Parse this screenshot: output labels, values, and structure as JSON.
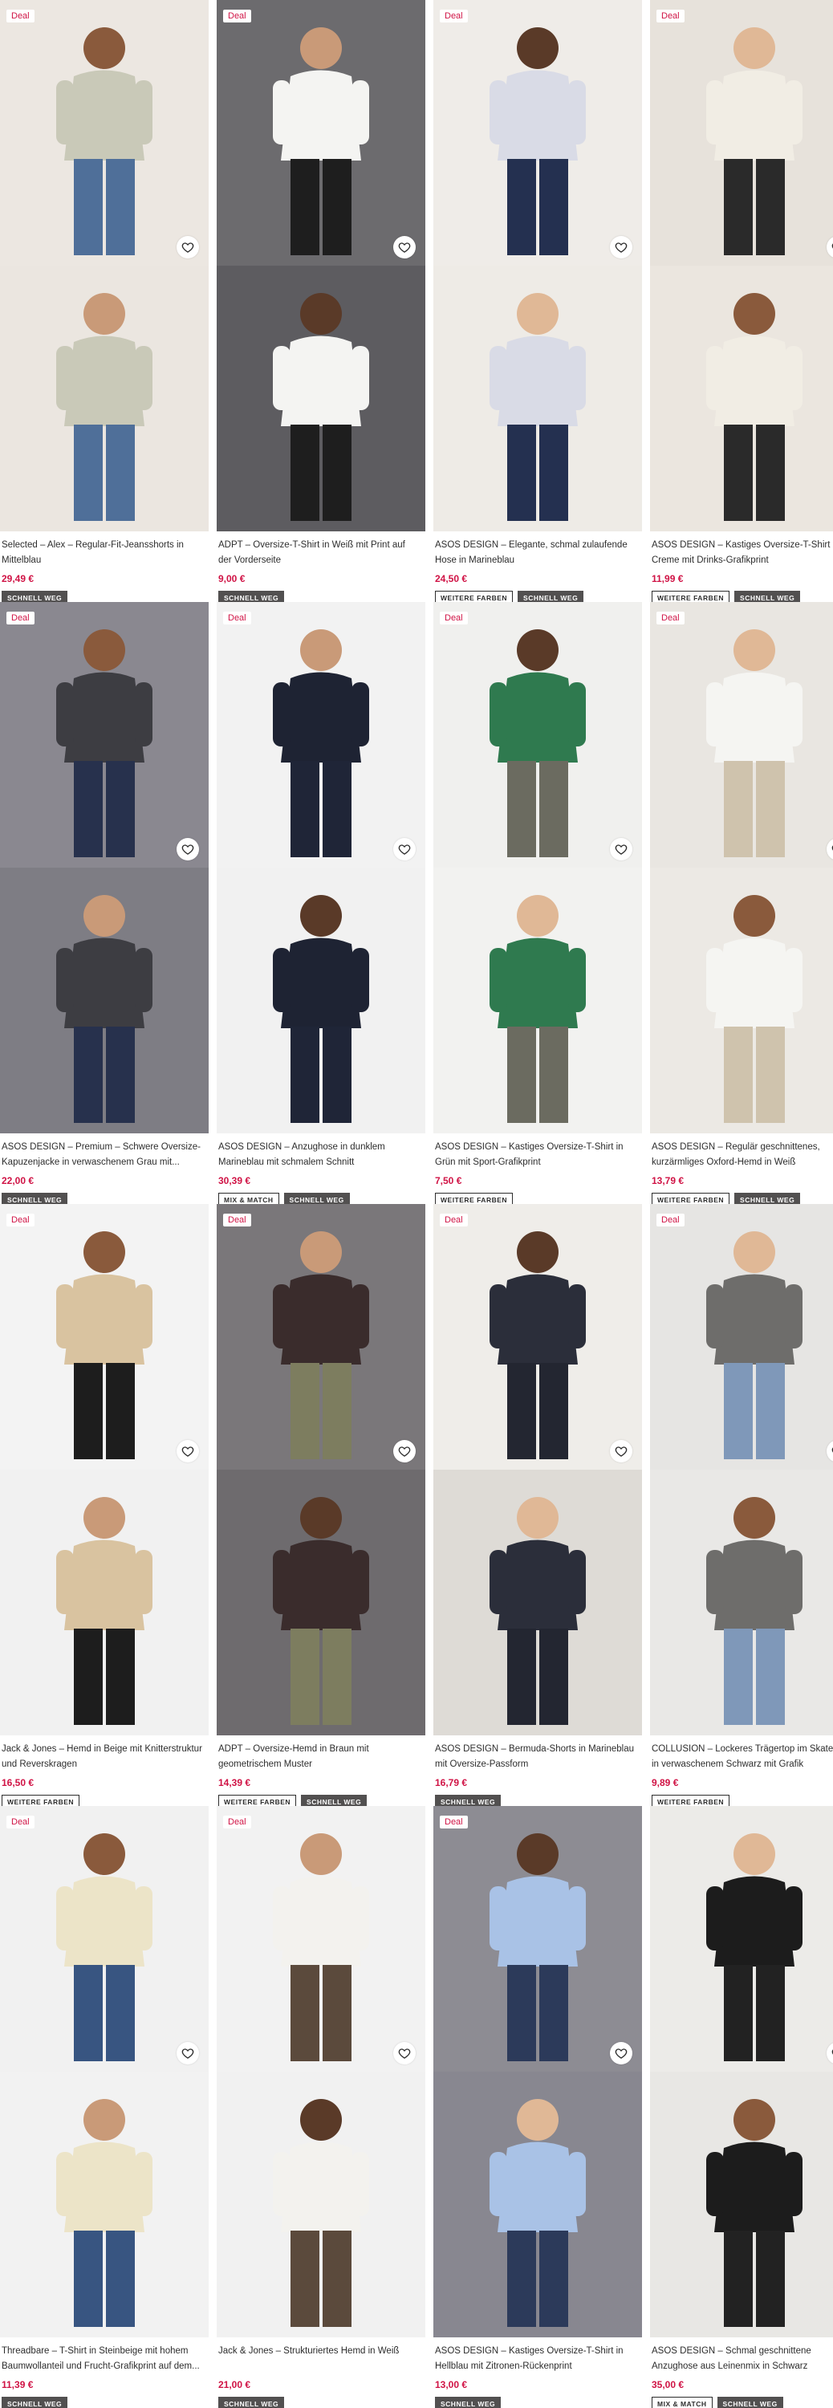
{
  "colors": {
    "price": "#d01345",
    "deal": "#d01345",
    "fast_badge_bg": "#525050"
  },
  "products": [
    {
      "title": "Selected – Alex – Regular-Fit-Jeansshorts in Mittelblau",
      "price": "29,49 €",
      "deal": "Deal",
      "badges": [
        "SCHNELL WEG"
      ],
      "bg1": "#ece7e1",
      "bg2": "#ebe6e0",
      "cloth1": "#c9c9b8",
      "cloth2": "#4f6f99"
    },
    {
      "title": "ADPT – Oversize-T-Shirt in Weiß mit Print auf der Vorderseite",
      "price": "9,00 €",
      "deal": "Deal",
      "badges": [
        "SCHNELL WEG"
      ],
      "bg1": "#6c6b6e",
      "bg2": "#5d5c60",
      "cloth1": "#f4f4f2",
      "cloth2": "#1e1e1e"
    },
    {
      "title": "ASOS DESIGN – Elegante, schmal zulaufende Hose in Marineblau",
      "price": "24,50 €",
      "deal": "Deal",
      "badges": [
        "WEITERE FARBEN",
        "SCHNELL WEG"
      ],
      "bg1": "#efece8",
      "bg2": "#eeebe6",
      "cloth1": "#d9dbe6",
      "cloth2": "#243050"
    },
    {
      "title": "ASOS DESIGN – Kastiges Oversize-T-Shirt in Creme mit Drinks-Grafikprint",
      "price": "11,99 €",
      "deal": "Deal",
      "badges": [
        "WEITERE FARBEN",
        "SCHNELL WEG"
      ],
      "bg1": "#e7e2db",
      "bg2": "#ebe6df",
      "cloth1": "#f1ede4",
      "cloth2": "#2a2a2a"
    },
    {
      "title": "ASOS DESIGN – Premium – Schwere Oversize-Kapuzenjacke in verwaschenem Grau mit...",
      "price": "22,00 €",
      "deal": "Deal",
      "badges": [
        "SCHNELL WEG"
      ],
      "bg1": "#8a8890",
      "bg2": "#7e7d84",
      "cloth1": "#3d3d42",
      "cloth2": "#27314d"
    },
    {
      "title": "ASOS DESIGN – Anzughose in dunklem Marineblau mit schmalem Schnitt",
      "price": "30,39 €",
      "deal": "Deal",
      "badges": [
        "MIX & MATCH",
        "SCHNELL WEG"
      ],
      "bg1": "#f2f2f2",
      "bg2": "#f1f1f1",
      "cloth1": "#1e2333",
      "cloth2": "#1f2537"
    },
    {
      "title": "ASOS DESIGN – Kastiges Oversize-T-Shirt in Grün mit Sport-Grafikprint",
      "price": "7,50 €",
      "deal": "Deal",
      "badges": [
        "WEITERE FARBEN"
      ],
      "bg1": "#f0f0ee",
      "bg2": "#f2f2f0",
      "cloth1": "#2f7a4f",
      "cloth2": "#6b6b60"
    },
    {
      "title": "ASOS DESIGN – Regulär geschnittenes, kurzärmliges Oxford-Hemd in Weiß",
      "price": "13,79 €",
      "deal": "Deal",
      "badges": [
        "WEITERE FARBEN",
        "SCHNELL WEG"
      ],
      "bg1": "#e9e6e1",
      "bg2": "#ece9e4",
      "cloth1": "#f5f5f2",
      "cloth2": "#cfc3ad"
    },
    {
      "title": "Jack & Jones – Hemd in Beige mit Knitterstruktur und Reverskragen",
      "price": "16,50 €",
      "deal": "Deal",
      "badges": [
        "WEITERE FARBEN"
      ],
      "bg1": "#f3f3f3",
      "bg2": "#f1f1f1",
      "cloth1": "#d9c3a0",
      "cloth2": "#1d1d1d"
    },
    {
      "title": "ADPT – Oversize-Hemd in Braun mit geometrischem Muster",
      "price": "14,39 €",
      "deal": "Deal",
      "badges": [
        "WEITERE FARBEN",
        "SCHNELL WEG"
      ],
      "bg1": "#7a777a",
      "bg2": "#6e6b6e",
      "cloth1": "#3a2c2c",
      "cloth2": "#7d7d5f"
    },
    {
      "title": "ASOS DESIGN – Bermuda-Shorts in Marineblau mit Oversize-Passform",
      "price": "16,79 €",
      "deal": "Deal",
      "badges": [
        "SCHNELL WEG"
      ],
      "bg1": "#efede9",
      "bg2": "#dedbd6",
      "cloth1": "#2b2e3a",
      "cloth2": "#232631"
    },
    {
      "title": "COLLUSION – Lockeres Trägertop im Skater-Stil in verwaschenem Schwarz mit Grafik",
      "price": "9,89 €",
      "deal": "Deal",
      "badges": [
        "WEITERE FARBEN"
      ],
      "bg1": "#e6e5e3",
      "bg2": "#e9e8e6",
      "cloth1": "#6e6d6b",
      "cloth2": "#7f98b9"
    },
    {
      "title": "Threadbare – T-Shirt in Steinbeige mit hohem Baumwollanteil und Frucht-Grafikprint auf dem...",
      "price": "11,39 €",
      "deal": "Deal",
      "badges": [
        "SCHNELL WEG"
      ],
      "bg1": "#f1f1f1",
      "bg2": "#f2f2f2",
      "cloth1": "#ece4c8",
      "cloth2": "#385581"
    },
    {
      "title": "Jack & Jones – Strukturiertes Hemd in Weiß",
      "price": "21,00 €",
      "deal": "Deal",
      "badges": [
        "SCHNELL WEG"
      ],
      "bg1": "#f2f2f2",
      "bg2": "#f1f1f1",
      "cloth1": "#f3f2ee",
      "cloth2": "#5b4a3c"
    },
    {
      "title": "ASOS DESIGN – Kastiges Oversize-T-Shirt in Hellblau mit Zitronen-Rückenprint",
      "price": "13,00 €",
      "deal": "Deal",
      "badges": [
        "SCHNELL WEG"
      ],
      "bg1": "#8d8c93",
      "bg2": "#888790",
      "cloth1": "#a9c2e6",
      "cloth2": "#2c3a5a"
    },
    {
      "title": "ASOS DESIGN – Schmal geschnittene Anzughose aus Leinenmix in Schwarz",
      "price": "35,00 €",
      "deal": "",
      "badges": [
        "MIX & MATCH",
        "SCHNELL WEG"
      ],
      "bg1": "#ecebe8",
      "bg2": "#e8e7e4",
      "cloth1": "#1c1c1c",
      "cloth2": "#222222"
    }
  ],
  "icons": {
    "wishlist": "heart-icon"
  }
}
